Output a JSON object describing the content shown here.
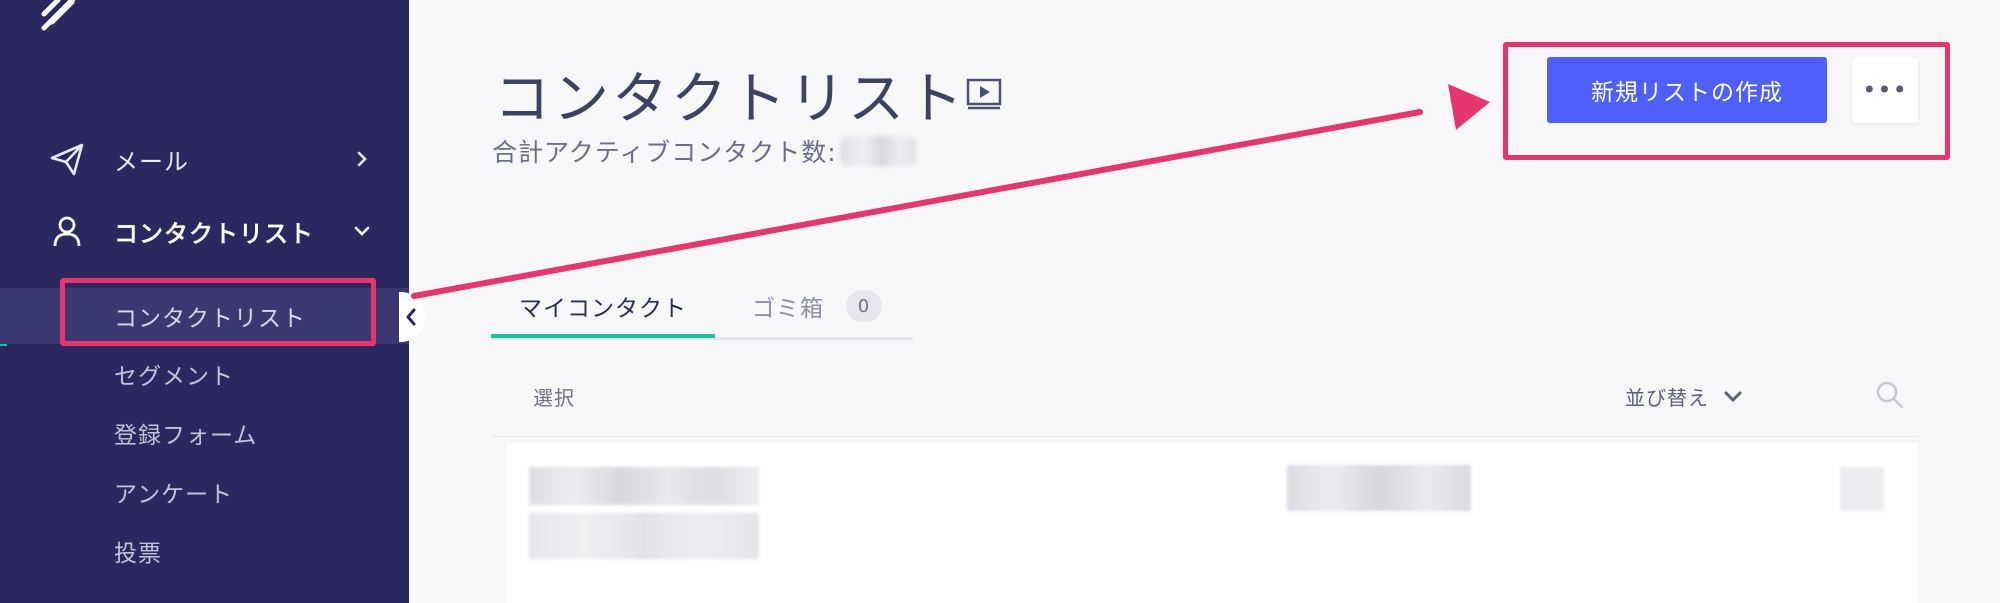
{
  "sidebar": {
    "nav": [
      {
        "label": "メール",
        "icon": "paper-plane-icon",
        "expanded": false
      },
      {
        "label": "コンタクトリスト",
        "icon": "user-icon",
        "expanded": true
      }
    ],
    "sub_items": [
      {
        "label": "コンタクトリスト",
        "current": true
      },
      {
        "label": "セグメント"
      },
      {
        "label": "登録フォーム"
      },
      {
        "label": "アンケート"
      },
      {
        "label": "投票"
      }
    ]
  },
  "header": {
    "title": "コンタクトリスト",
    "subtitle": "合計アクティブコンタクト数:",
    "new_list_button": "新規リストの作成",
    "more_button": "•••"
  },
  "tabs": [
    {
      "label": "マイコンタクト",
      "active": true
    },
    {
      "label": "ゴミ箱",
      "count": "0"
    }
  ],
  "list_header": {
    "select_label": "選択",
    "sort_label": "並び替え"
  },
  "colors": {
    "sidebar_bg": "#2b2860",
    "accent_green": "#18c39b",
    "primary_button": "#4f5ffa",
    "annotation_pink": "#e8356f"
  }
}
